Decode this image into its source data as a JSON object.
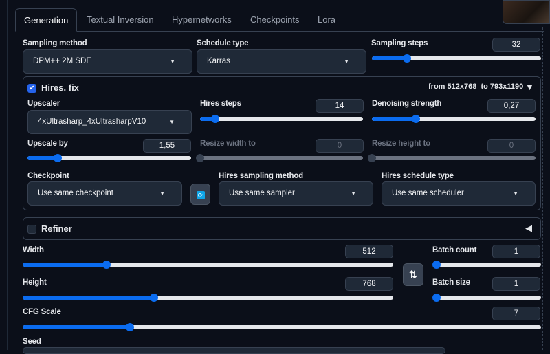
{
  "tabs": [
    "Generation",
    "Textual Inversion",
    "Hypernetworks",
    "Checkpoints",
    "Lora"
  ],
  "sampling_method": {
    "label": "Sampling method",
    "value": "DPM++ 2M SDE"
  },
  "schedule_type": {
    "label": "Schedule type",
    "value": "Karras"
  },
  "sampling_steps": {
    "label": "Sampling steps",
    "display": "32",
    "value": 32,
    "min": 1,
    "max": 150
  },
  "hires": {
    "label": "Hires. fix",
    "checked": true,
    "info_from": "from",
    "info_size1": "512x768",
    "info_to": "to",
    "info_size2": "793x1190",
    "upscaler": {
      "label": "Upscaler",
      "value": "4xUltrasharp_4xUltrasharpV10"
    },
    "steps": {
      "label": "Hires steps",
      "display": "14",
      "value": 14,
      "min": 0,
      "max": 150
    },
    "denoise": {
      "label": "Denoising strength",
      "display": "0,27",
      "value": 0.27,
      "min": 0,
      "max": 1
    },
    "upscale_by": {
      "label": "Upscale by",
      "display": "1,55",
      "value": 1.55,
      "min": 1,
      "max": 4
    },
    "resize_w": {
      "label": "Resize width to",
      "display": "0",
      "value": 0,
      "min": 0,
      "max": 2048
    },
    "resize_h": {
      "label": "Resize height to",
      "display": "0",
      "value": 0,
      "min": 0,
      "max": 2048
    },
    "checkpoint": {
      "label": "Checkpoint",
      "value": "Use same checkpoint"
    },
    "sampler": {
      "label": "Hires sampling method",
      "value": "Use same sampler"
    },
    "scheduler": {
      "label": "Hires schedule type",
      "value": "Use same scheduler"
    }
  },
  "refiner": {
    "label": "Refiner",
    "checked": false
  },
  "width": {
    "label": "Width",
    "display": "512",
    "value": 512,
    "min": 64,
    "max": 2048
  },
  "height": {
    "label": "Height",
    "display": "768",
    "value": 768,
    "min": 64,
    "max": 2048
  },
  "batch_count": {
    "label": "Batch count",
    "display": "1",
    "value": 1,
    "min": 1,
    "max": 100
  },
  "batch_size": {
    "label": "Batch size",
    "display": "1",
    "value": 1,
    "min": 1,
    "max": 8
  },
  "cfg": {
    "label": "CFG Scale",
    "display": "7",
    "value": 7,
    "min": 1,
    "max": 30
  },
  "seed": {
    "label": "Seed"
  }
}
